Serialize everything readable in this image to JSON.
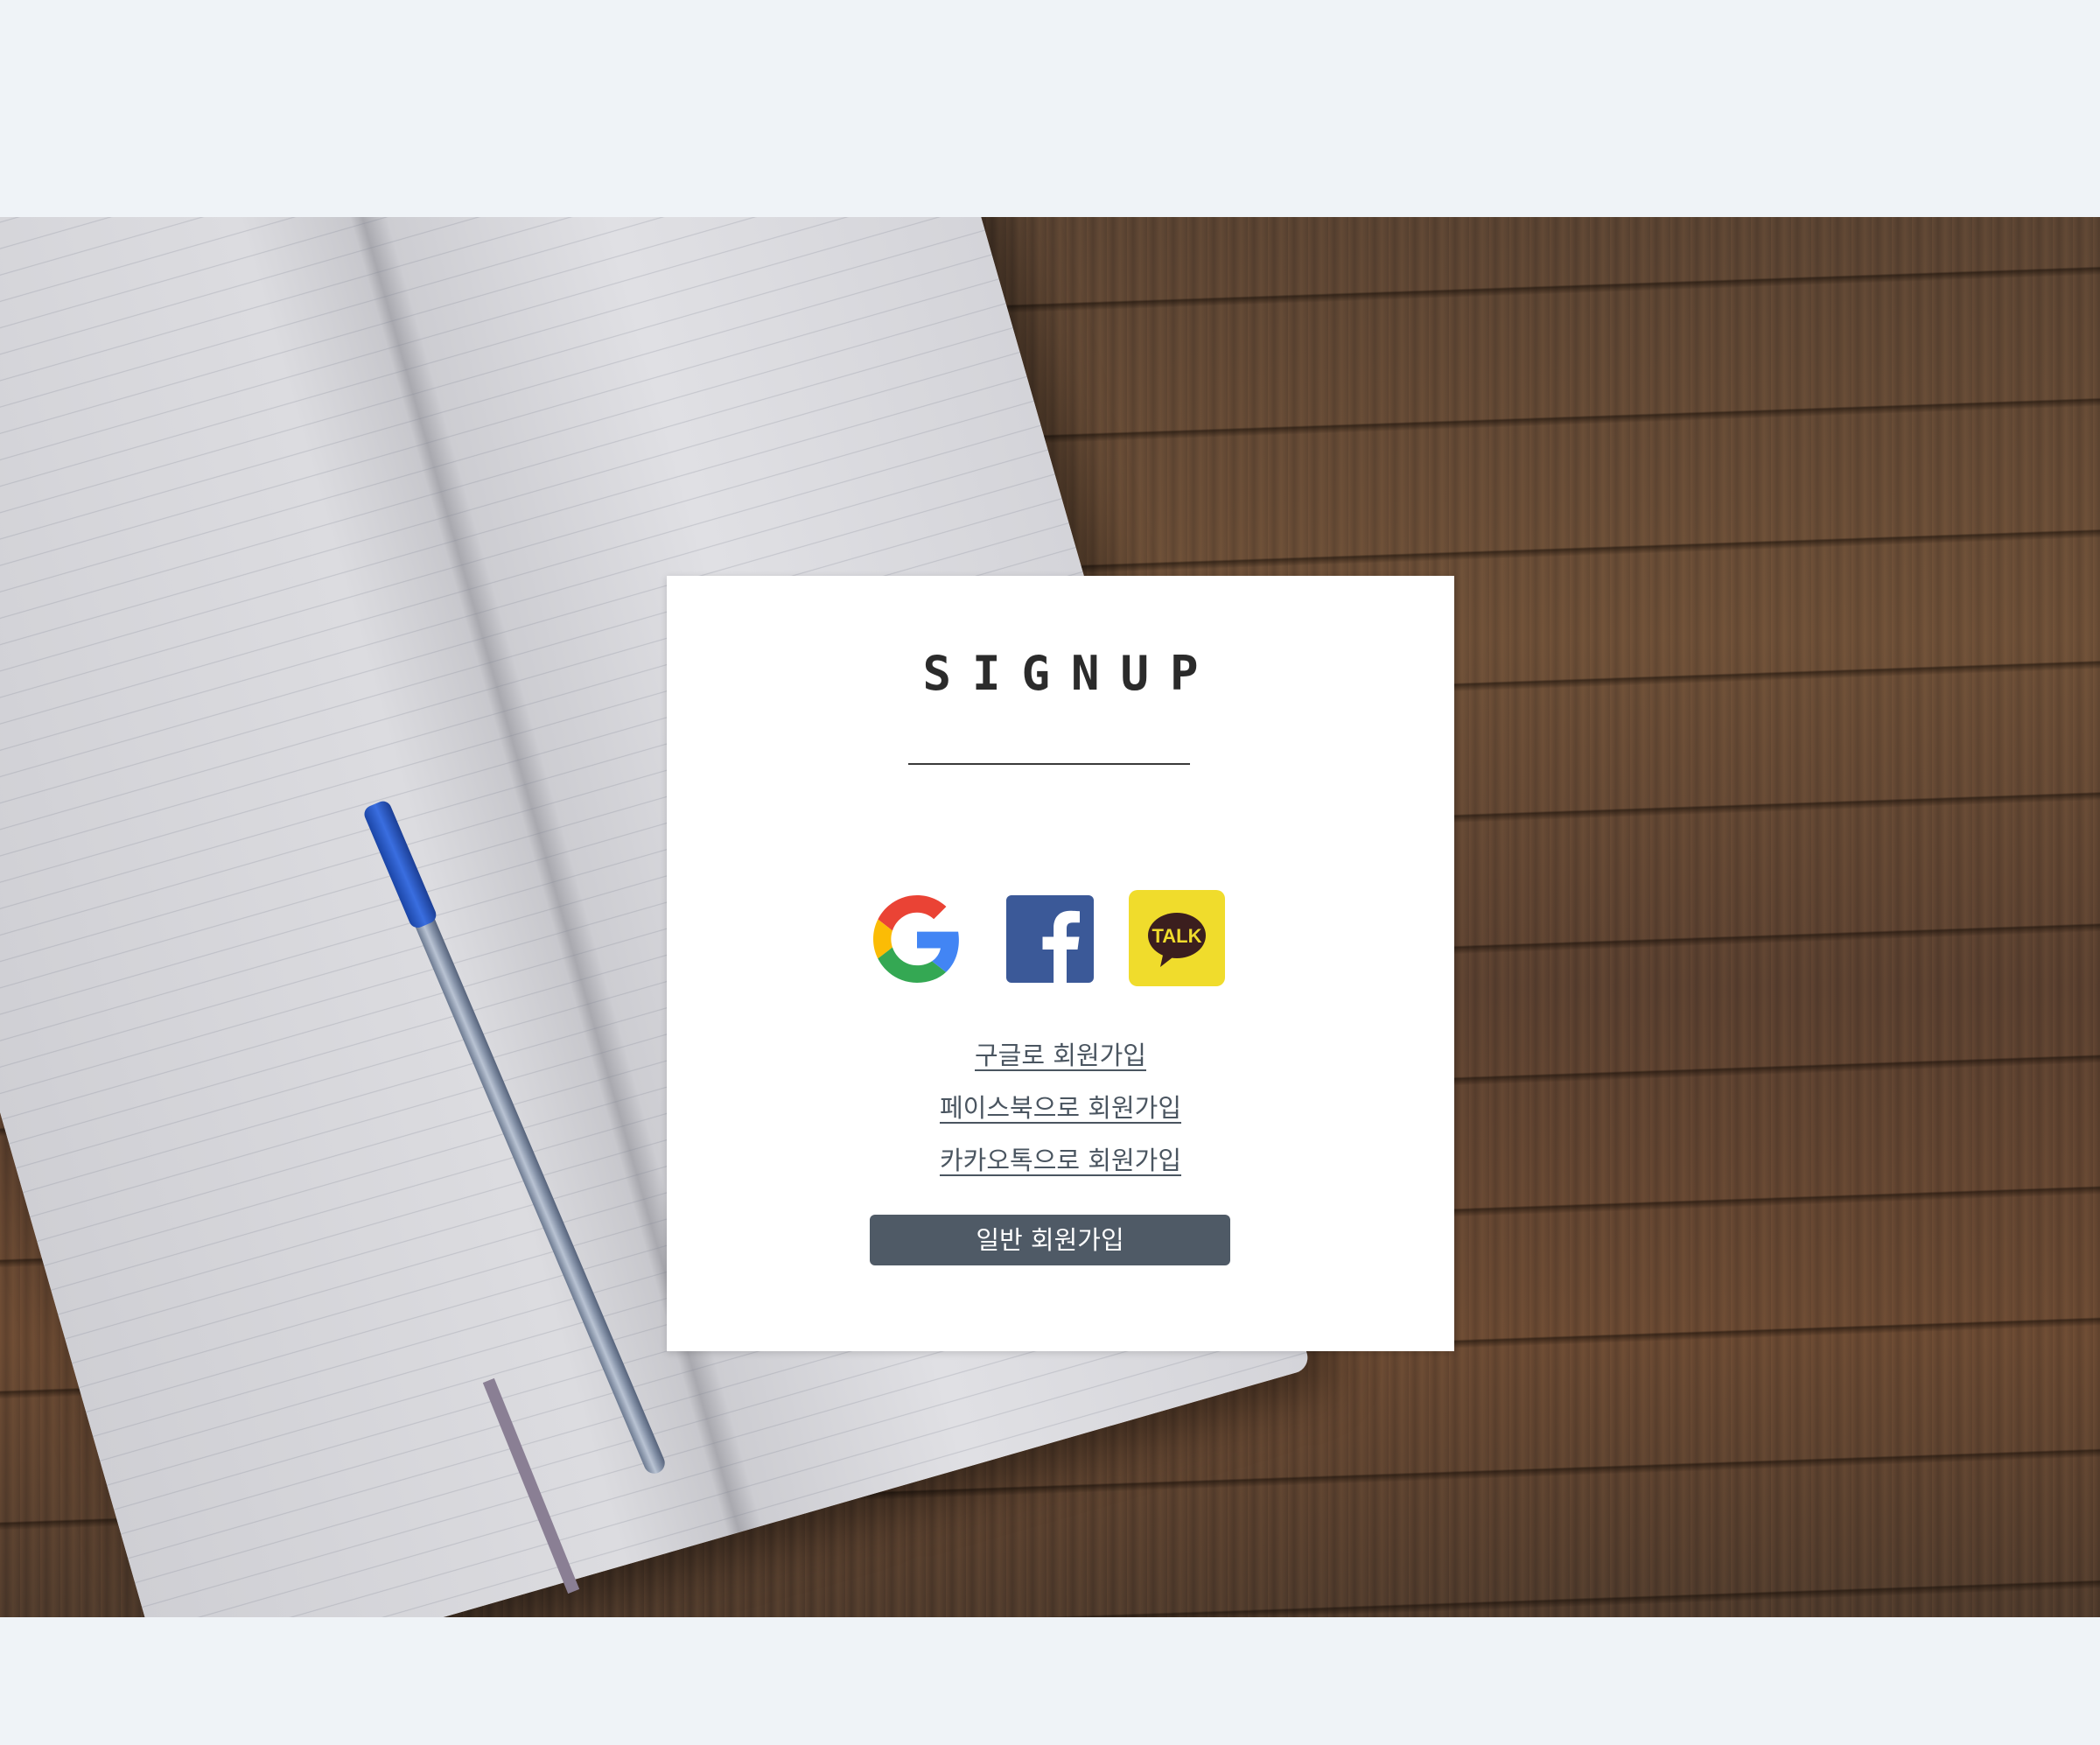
{
  "page": {
    "title": "SIGNUP"
  },
  "social": {
    "icons": [
      {
        "name": "google-icon",
        "label": "Google"
      },
      {
        "name": "facebook-icon",
        "label": "Facebook"
      },
      {
        "name": "kakao-icon",
        "label": "TALK"
      }
    ],
    "links": {
      "google": "구글로 회원가입",
      "facebook": "페이스북으로 회원가입",
      "kakao": "카카오톡으로 회원가입"
    }
  },
  "actions": {
    "general_signup": "일반 회원가입"
  },
  "colors": {
    "page_background": "#eff3f7",
    "card_background": "#ffffff",
    "button_background": "#4f5a66",
    "link_text": "#4a5560",
    "facebook_blue": "#3b5998",
    "kakao_yellow": "#f9e000"
  }
}
